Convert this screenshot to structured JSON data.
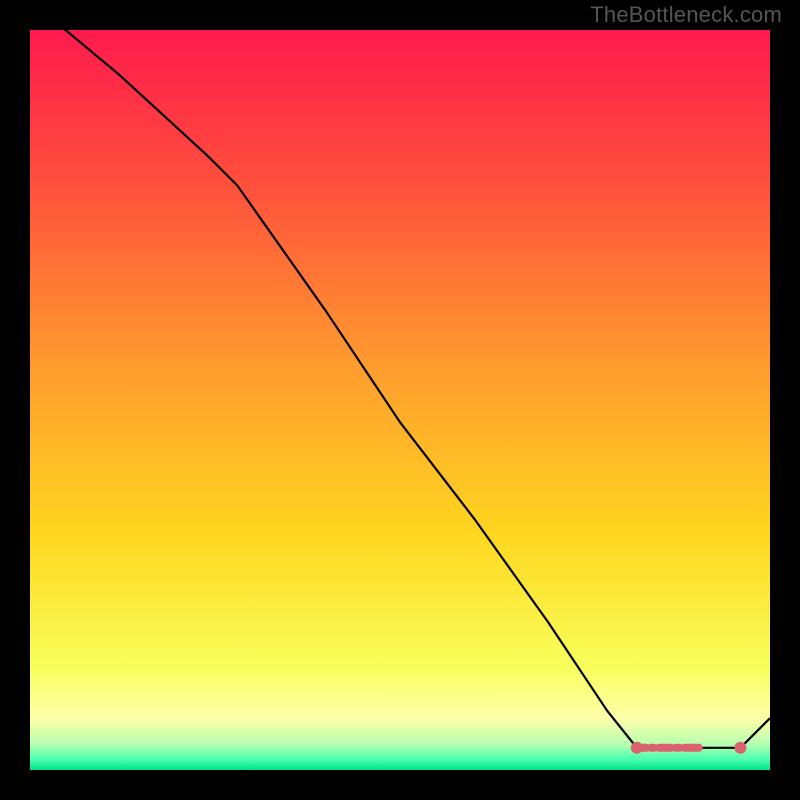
{
  "watermark": "TheBottleneck.com",
  "chart_data": {
    "type": "line",
    "title": "",
    "xlabel": "",
    "ylabel": "",
    "xlim": [
      0,
      100
    ],
    "ylim": [
      0,
      100
    ],
    "grid": false,
    "legend": false,
    "series": [
      {
        "name": "curve",
        "x": [
          0,
          12,
          24,
          28,
          40,
          50,
          60,
          70,
          78,
          82,
          93,
          96,
          100
        ],
        "y": [
          104,
          94,
          83,
          79,
          62,
          47,
          34,
          20,
          8,
          3,
          3,
          3,
          7
        ]
      }
    ],
    "points": [
      {
        "x": 82,
        "y": 3
      },
      {
        "x": 96,
        "y": 3
      }
    ],
    "background_gradient_stops": [
      {
        "offset": 0,
        "color": "#ff1a4d"
      },
      {
        "offset": 0.2,
        "color": "#ff4d3d"
      },
      {
        "offset": 0.45,
        "color": "#ff9a2e"
      },
      {
        "offset": 0.68,
        "color": "#ffd61f"
      },
      {
        "offset": 0.86,
        "color": "#f8ff5a"
      },
      {
        "offset": 0.93,
        "color": "#ffffaa"
      },
      {
        "offset": 0.965,
        "color": "#b7ffb0"
      },
      {
        "offset": 0.985,
        "color": "#4dffb0"
      },
      {
        "offset": 1.0,
        "color": "#00e28a"
      }
    ],
    "marker_color": "#d9626e",
    "line_color": "#000000"
  }
}
